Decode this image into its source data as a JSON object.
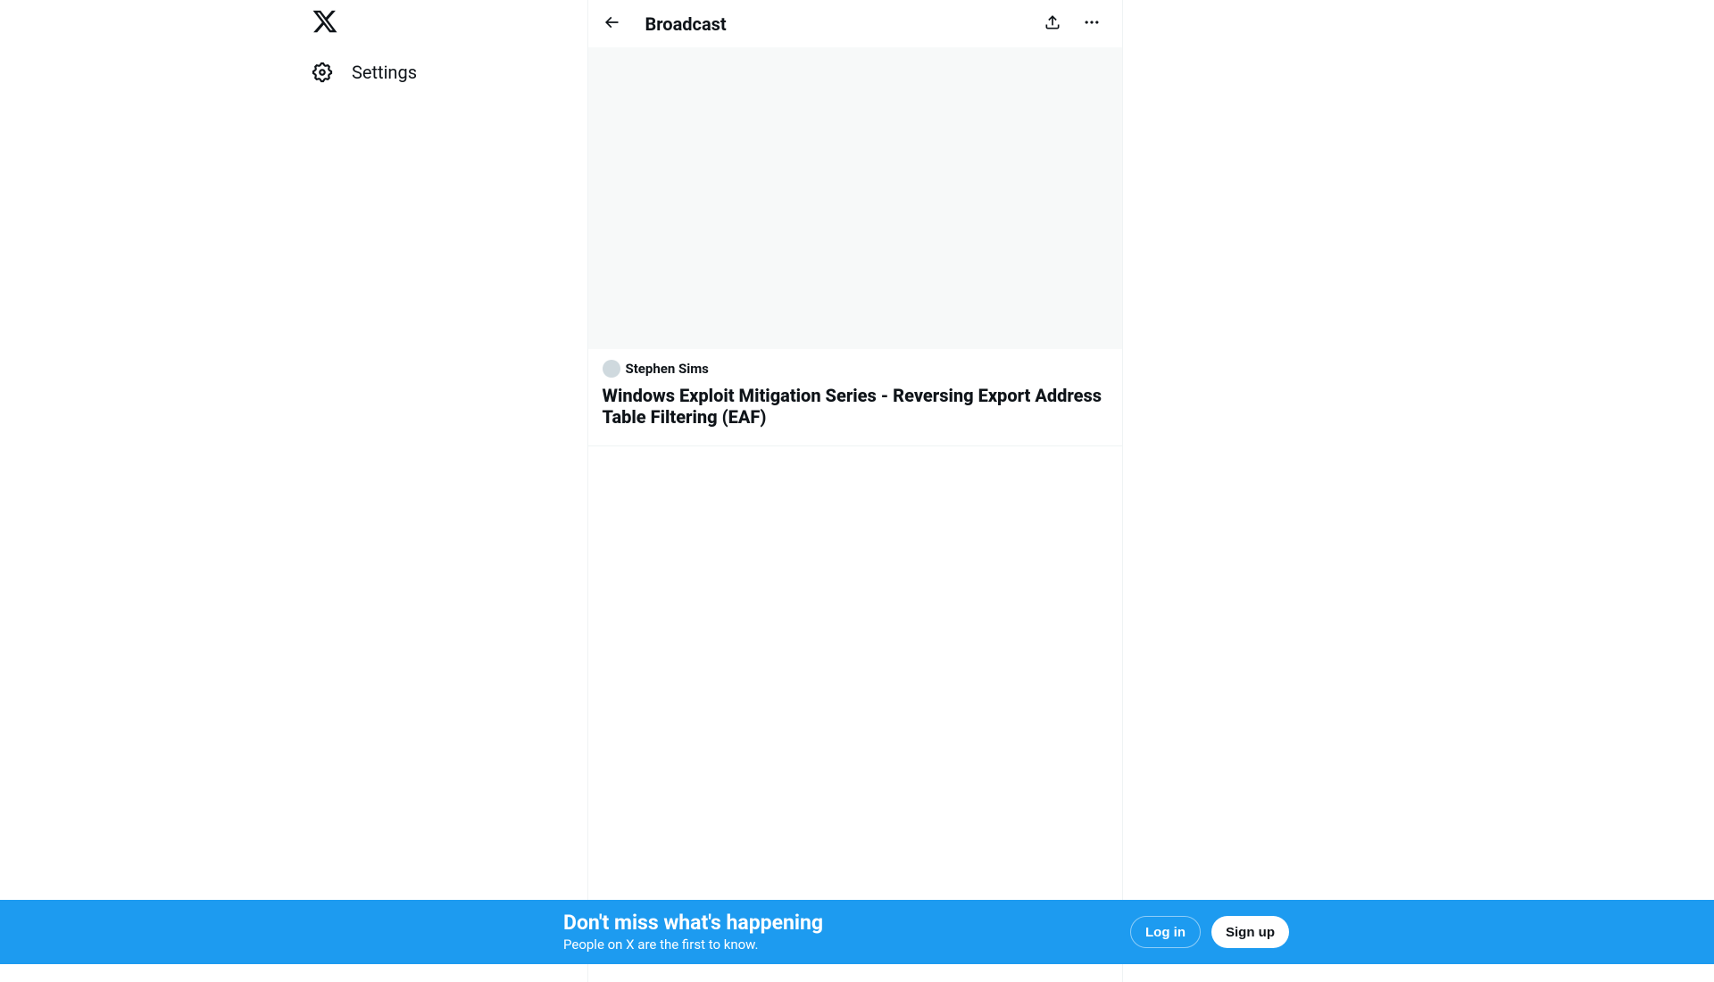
{
  "sidebar": {
    "settings_label": "Settings"
  },
  "header": {
    "title": "Broadcast"
  },
  "broadcast": {
    "author_name": "Stephen Sims",
    "title": "Windows Exploit Mitigation Series - Reversing Export Address Table Filtering (EAF)"
  },
  "banner": {
    "title": "Don't miss what's happening",
    "subtitle": "People on X are the first to know.",
    "login_label": "Log in",
    "signup_label": "Sign up"
  }
}
